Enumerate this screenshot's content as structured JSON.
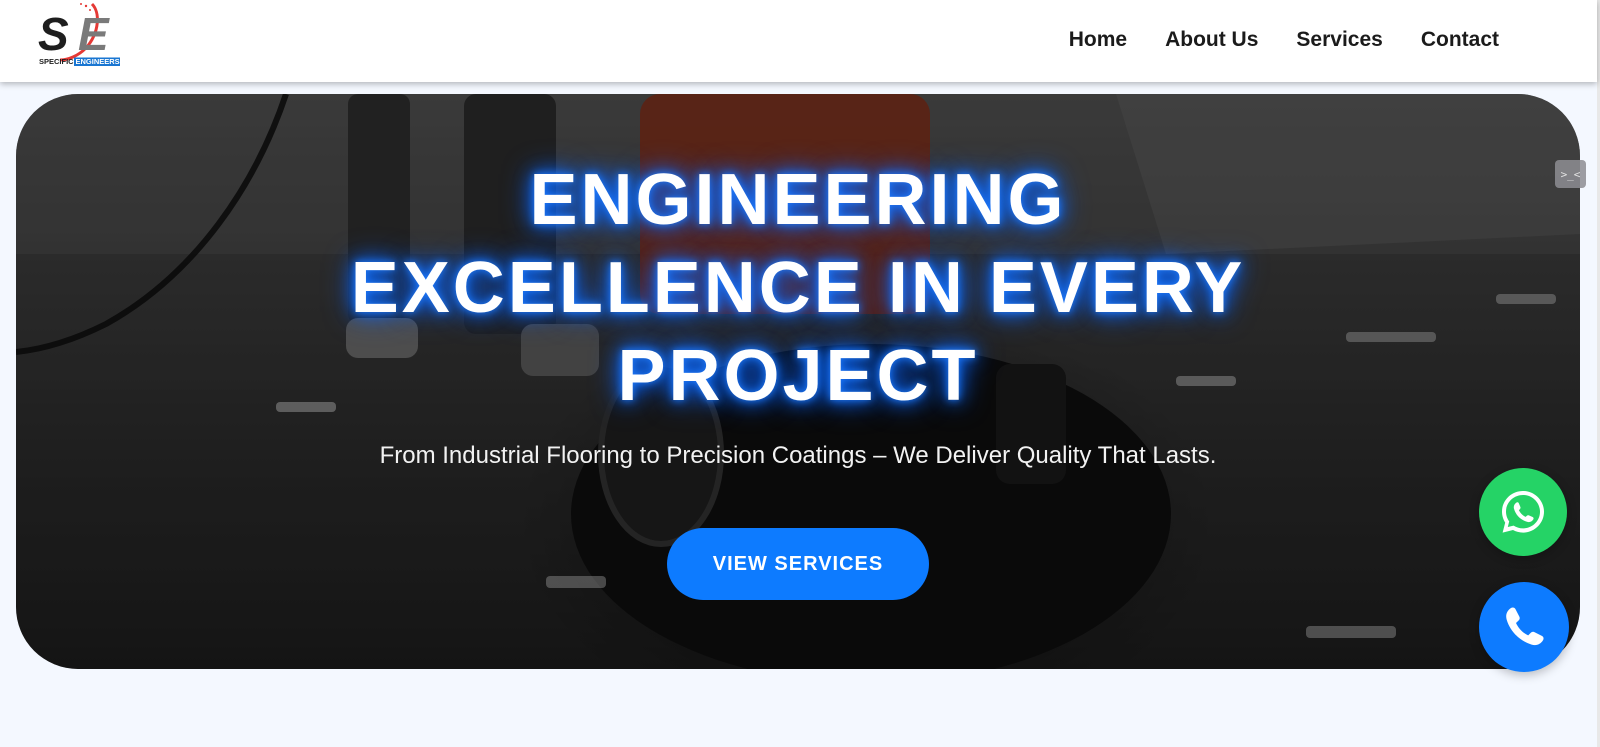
{
  "header": {
    "logo": {
      "text_main": "SE",
      "text_left": "SPECIFIC",
      "text_right": "ENGINEERS"
    },
    "nav": [
      {
        "label": "Home"
      },
      {
        "label": "About Us"
      },
      {
        "label": "Services"
      },
      {
        "label": "Contact"
      }
    ]
  },
  "hero": {
    "title": "ENGINEERING EXCELLENCE IN EVERY PROJECT",
    "subtitle": "From Industrial Flooring to Precision Coatings – We Deliver Quality That Lasts.",
    "cta_label": "VIEW SERVICES"
  },
  "floating": {
    "whatsapp_icon": "whatsapp-icon",
    "phone_icon": "phone-icon",
    "devtools_label": ">_<"
  },
  "colors": {
    "accent": "#0d7bff",
    "whatsapp": "#25d366",
    "title_glow": "#0a6cff",
    "logo_red": "#e53935",
    "logo_blue": "#1976d2"
  }
}
